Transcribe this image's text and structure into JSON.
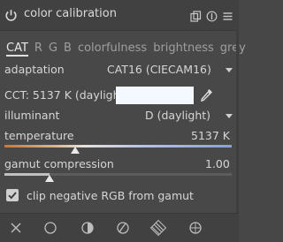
{
  "header": {
    "title": "color calibration",
    "icons": [
      "power-icon",
      "copy-icon",
      "reset-icon",
      "menu-icon"
    ]
  },
  "tabs": [
    {
      "label": "CAT",
      "active": true
    },
    {
      "label": "R",
      "active": false
    },
    {
      "label": "G",
      "active": false
    },
    {
      "label": "B",
      "active": false
    },
    {
      "label": "colorfulness",
      "active": false
    },
    {
      "label": "brightness",
      "active": false
    },
    {
      "label": "grey",
      "active": false
    }
  ],
  "adaptation": {
    "label": "adaptation",
    "value": "CAT16 (CIECAM16)"
  },
  "cct": {
    "label": "CCT: 5137 K (daylight)",
    "swatch_color": "#f4f8ff"
  },
  "illuminant": {
    "label": "illuminant",
    "value": "D (daylight)"
  },
  "temperature": {
    "label": "temperature",
    "value": "5137 K",
    "fraction": 0.31
  },
  "gamut": {
    "label": "gamut compression",
    "value": "1.00",
    "fraction": 0.2
  },
  "clip": {
    "label": "clip negative RGB from gamut",
    "checked": true
  },
  "footer_icons": [
    "close-icon",
    "circle-icon",
    "blend-icon",
    "parametric-mask-icon",
    "drawn-parametric-mask-icon",
    "raster-mask-icon"
  ],
  "colors": {
    "panel_bg": "#484848",
    "header_bg": "#414141",
    "text": "#d6d6d6"
  }
}
